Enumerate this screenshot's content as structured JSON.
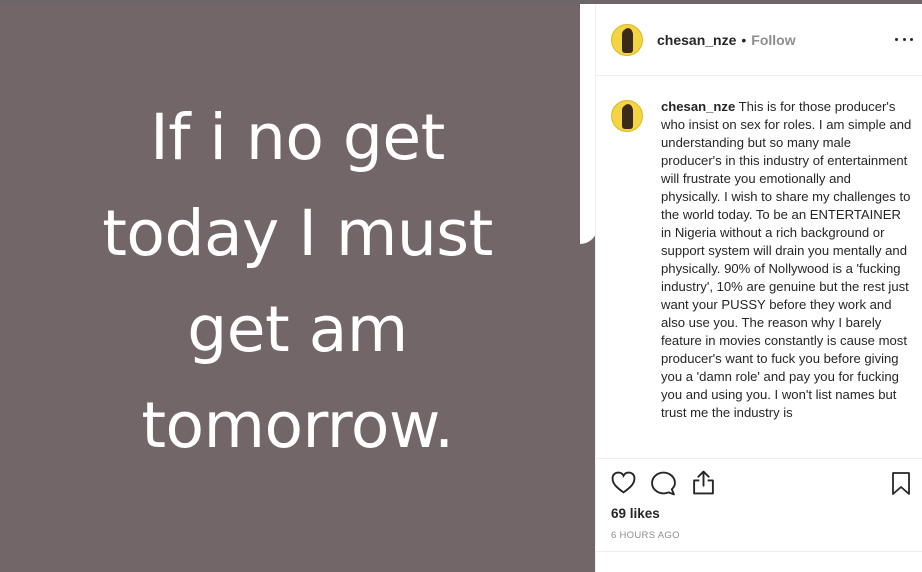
{
  "image": {
    "lines": [
      "If i no get",
      "today I must",
      "get am",
      "tomorrow."
    ],
    "background_color": "#726669"
  },
  "header": {
    "username": "chesan_nze",
    "separator": "•",
    "follow_label": "Follow",
    "more_icon": "more-icon"
  },
  "caption": {
    "username": "chesan_nze",
    "text": "This is for those producer's who insist on sex for roles. I am simple and understanding but so many male producer's in this industry of entertainment will frustrate you emotionally and physically. I wish to share my challenges to the world today. To be an ENTERTAINER in Nigeria without a rich background or support system will drain you mentally and physically. 90% of Nollywood is a 'fucking industry', 10% are genuine but the rest just want your PUSSY before they work and also use you. The reason why I barely feature in movies constantly is cause most producer's want to fuck you before giving you a 'damn role' and pay you for fucking you and using you. I won't list names but trust me the industry is"
  },
  "actions": {
    "icons": [
      "heart-icon",
      "comment-icon",
      "share-icon",
      "bookmark-icon"
    ],
    "likes": "69 likes",
    "time": "6 HOURS AGO"
  }
}
